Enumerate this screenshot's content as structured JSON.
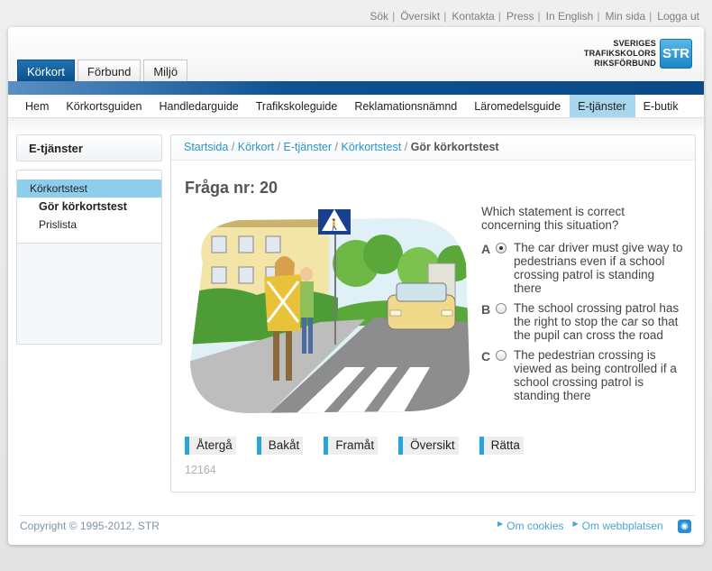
{
  "top_links": [
    "Sök",
    "Översikt",
    "Kontakta",
    "Press",
    "In English",
    "Min sida",
    "Logga ut"
  ],
  "tabs": [
    {
      "label": "Körkort",
      "active": true
    },
    {
      "label": "Förbund",
      "active": false
    },
    {
      "label": "Miljö",
      "active": false
    }
  ],
  "logo": {
    "line1": "SVERIGES",
    "line2": "TRAFIKSKOLORS",
    "line3": "RIKSFÖRBUND",
    "badge": "STR"
  },
  "main_nav": [
    {
      "label": "Hem"
    },
    {
      "label": "Körkortsguiden"
    },
    {
      "label": "Handledarguide"
    },
    {
      "label": "Trafikskoleguide"
    },
    {
      "label": "Reklamationsnämnd"
    },
    {
      "label": "Läromedelsguide"
    },
    {
      "label": "E-tjänster",
      "active": true
    },
    {
      "label": "E-butik"
    }
  ],
  "sidebar": {
    "title": "E-tjänster",
    "items": [
      {
        "label": "Körkortstest",
        "active": true
      },
      {
        "label": "Gör körkortstest",
        "bold": true
      },
      {
        "label": "Prislista"
      }
    ]
  },
  "breadcrumb": {
    "links": [
      "Startsida",
      "Körkort",
      "E-tjänster",
      "Körkortstest"
    ],
    "separator": "/",
    "current": "Gör körkortstest"
  },
  "question": {
    "title": "Fråga nr: 20",
    "text": "Which statement is correct concerning this situation?",
    "options": [
      {
        "letter": "A",
        "checked": true,
        "text": "The car driver must give way to pedestrians even if a school crossing patrol is standing there"
      },
      {
        "letter": "B",
        "checked": false,
        "text": "The school crossing patrol has the right to stop the car so that the pupil can cross the road"
      },
      {
        "letter": "C",
        "checked": false,
        "text": "The pedestrian crossing is viewed as being controlled if a school crossing patrol is standing there"
      }
    ],
    "id": "12164"
  },
  "buttons": [
    "Återgå",
    "Bakåt",
    "Framåt",
    "Översikt",
    "Rätta"
  ],
  "footer": {
    "copyright": "Copyright © 1995-2012, STR",
    "links": [
      "Om cookies",
      "Om webbplatsen"
    ]
  },
  "colors": {
    "brand_blue": "#0b4f8c",
    "accent": "#2ba3db",
    "nav_active": "#a9d6ef"
  }
}
